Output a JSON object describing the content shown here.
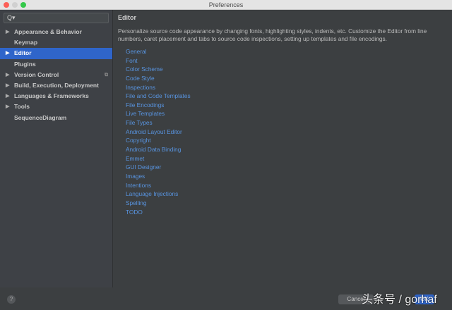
{
  "window": {
    "title": "Preferences"
  },
  "sidebar": {
    "search_placeholder": "Q▾",
    "items": [
      {
        "label": "Appearance & Behavior",
        "expandable": true
      },
      {
        "label": "Keymap",
        "expandable": false
      },
      {
        "label": "Editor",
        "expandable": true,
        "selected": true
      },
      {
        "label": "Plugins",
        "expandable": false
      },
      {
        "label": "Version Control",
        "expandable": true
      },
      {
        "label": "Build, Execution, Deployment",
        "expandable": true
      },
      {
        "label": "Languages & Frameworks",
        "expandable": true
      },
      {
        "label": "Tools",
        "expandable": true
      },
      {
        "label": "SequenceDiagram",
        "expandable": false
      }
    ]
  },
  "main": {
    "title": "Editor",
    "description": "Personalize source code appearance by changing fonts, highlighting styles, indents, etc. Customize the Editor from line numbers, caret placement and tabs to source code inspections, setting up templates and file encodings.",
    "links": [
      "General",
      "Font",
      "Color Scheme",
      "Code Style",
      "Inspections",
      "File and Code Templates",
      "File Encodings",
      "Live Templates",
      "File Types",
      "Android Layout Editor",
      "Copyright",
      "Android Data Binding",
      "Emmet",
      "GUI Designer",
      "Images",
      "Intentions",
      "Language Injections",
      "Spelling",
      "TODO"
    ]
  },
  "footer": {
    "help": "?",
    "cancel": "Cancel",
    "ok": "OK"
  },
  "watermark": "头条号 / gorhaf",
  "colors": {
    "accent": "#2f65ca",
    "link": "#5894e0"
  }
}
